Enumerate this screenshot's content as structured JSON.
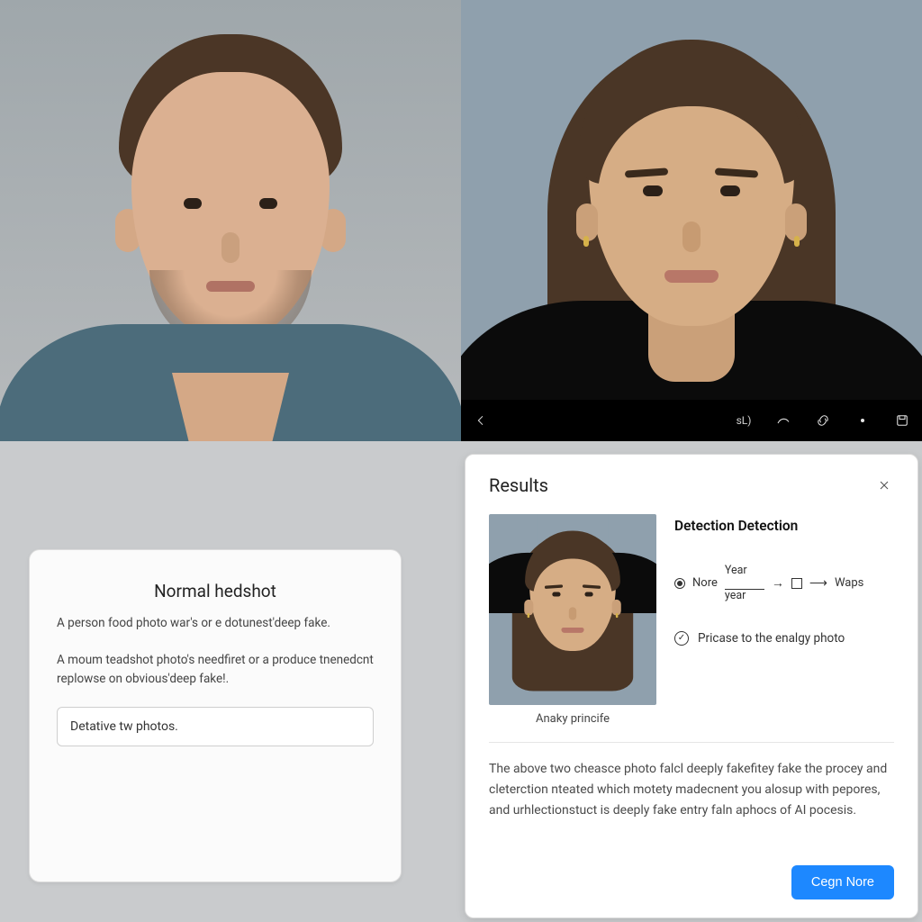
{
  "photos": {
    "left_alt": "Normal headshot (man)",
    "right_alt": "Headshot (woman) in image editor"
  },
  "editor_toolbar": {
    "back_label": "back",
    "label_small": "sL)",
    "tool_draw": "draw",
    "tool_link": "link",
    "tool_more": "more",
    "tool_save": "save"
  },
  "left_card": {
    "title": "Normal hedshot",
    "line1": "A person food photo war's or e dotunest'deep fake.",
    "line2": "A moum teadshot photo's needfiret or a produce tnenedcnt replowse on obvious'deep fake!.",
    "input_value": "Detative tw photos."
  },
  "results": {
    "title": "Results",
    "close_label": "Close",
    "thumb_caption": "Anaky princife",
    "detection_heading": "Detection Detection",
    "flow": {
      "option_label": "Nore",
      "year_top": "Year",
      "year_bottom": "year",
      "end_label": "Waps"
    },
    "checkbox_label": "Pricase to the enalgy photo",
    "description": "The above two cheasce photo falcl deeply fakefitey fake the procey and cleterction nteated which motety madecnent you alosup with pepores, and urhlectionstuct is deeply fake entry faln aphocs of AI pocesis.",
    "primary_button": "Cegn Nore"
  }
}
